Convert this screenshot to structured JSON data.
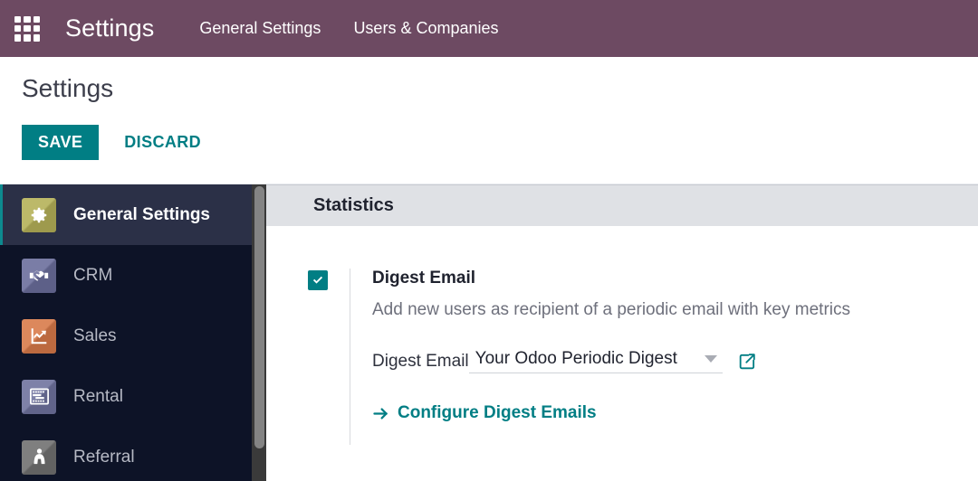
{
  "navbar": {
    "apps_icon": "apps-grid-icon",
    "brand": "Settings",
    "menu": [
      {
        "label": "General Settings"
      },
      {
        "label": "Users & Companies"
      }
    ],
    "background_color": "#6d4a62"
  },
  "control_panel": {
    "title": "Settings",
    "save_label": "SAVE",
    "discard_label": "DISCARD",
    "accent_color": "#017e84"
  },
  "sidebar": {
    "items": [
      {
        "label": "General Settings",
        "icon": "gear-icon",
        "icon_color": "#b5b158",
        "active": true
      },
      {
        "label": "CRM",
        "icon": "handshake-icon",
        "icon_color": "#6b6e9c",
        "active": false
      },
      {
        "label": "Sales",
        "icon": "chart-line-up-icon",
        "icon_color": "#d87a4a",
        "active": false
      },
      {
        "label": "Rental",
        "icon": "calendar-bars-icon",
        "icon_color": "#6f739e",
        "active": false
      },
      {
        "label": "Referral",
        "icon": "person-cape-icon",
        "icon_color": "#717171",
        "active": false
      }
    ],
    "background_color": "#0d1327",
    "active_background": "#2b3047",
    "active_marker_color": "#0d8a8f"
  },
  "main": {
    "section_title": "Statistics",
    "setting": {
      "checkbox_checked": true,
      "label": "Digest Email",
      "help": "Add new users as recipient of a periodic email with key metrics",
      "field_label": "Digest Email",
      "field_value": "Your Odoo Periodic Digest",
      "dropdown_icon": "chevron-down-icon",
      "external_link_icon": "external-link-icon",
      "configure_link": "Configure Digest Emails",
      "configure_arrow_icon": "arrow-right-icon"
    }
  }
}
